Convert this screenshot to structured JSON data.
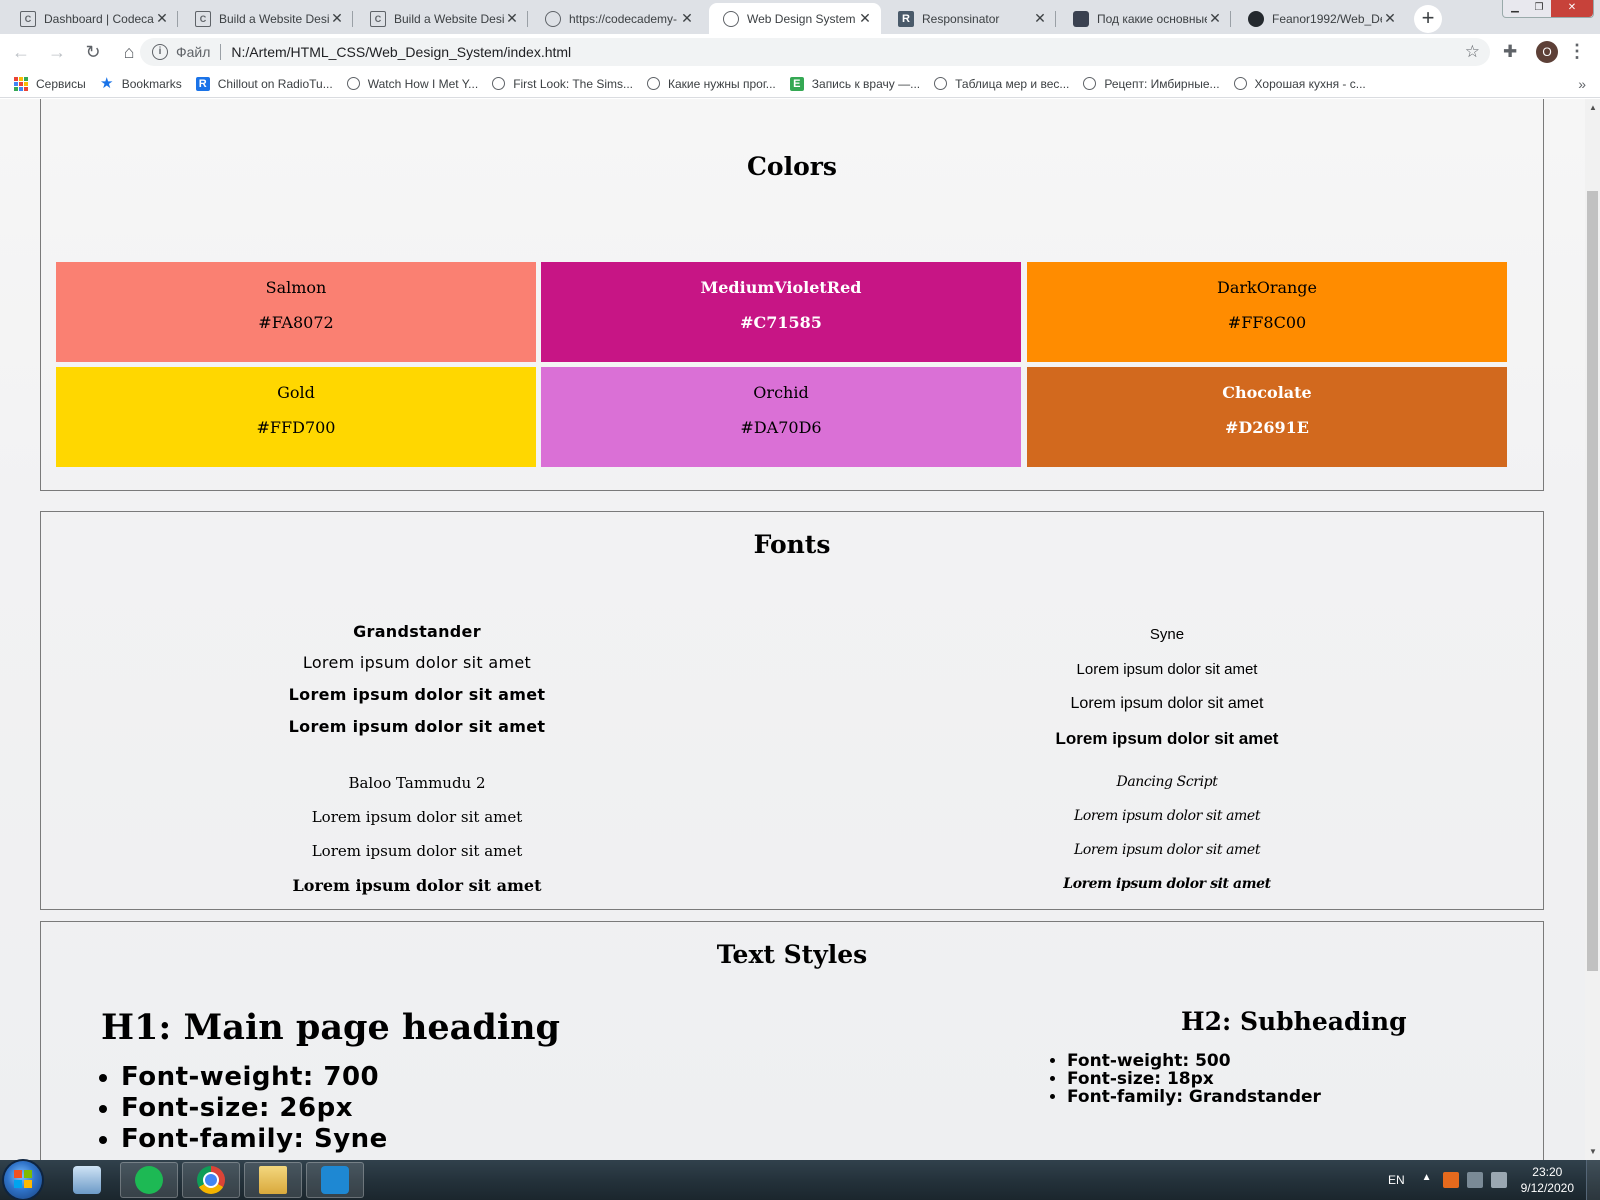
{
  "browser": {
    "tabs": [
      {
        "title": "Dashboard | Codecademy",
        "icon": "codecademy-icon",
        "active": false
      },
      {
        "title": "Build a Website Design System",
        "icon": "codecademy-icon",
        "active": false
      },
      {
        "title": "Build a Website Design System",
        "icon": "codecademy-icon",
        "active": false
      },
      {
        "title": "https://codecademy-",
        "icon": "globe-icon",
        "active": false
      },
      {
        "title": "Web Design System",
        "icon": "globe-icon",
        "active": true
      },
      {
        "title": "Responsinator",
        "icon": "r-icon",
        "active": false
      },
      {
        "title": "Под какие основные",
        "icon": "habr-icon",
        "active": false
      },
      {
        "title": "Feanor1992/Web_De",
        "icon": "github-icon",
        "active": false
      }
    ],
    "address": {
      "scheme_label": "Файл",
      "url": "N:/Artem/HTML_CSS/Web_Design_System/index.html"
    },
    "profile_initial": "O",
    "bookmarks": [
      {
        "label": "Сервисы",
        "icon": "apps-icon"
      },
      {
        "label": "Bookmarks",
        "icon": "star-icon"
      },
      {
        "label": "Chillout on RadioTu...",
        "icon": "radio-icon"
      },
      {
        "label": "Watch How I Met Y...",
        "icon": "globe-icon"
      },
      {
        "label": "First Look: The Sims...",
        "icon": "globe-icon"
      },
      {
        "label": "Какие нужны прог...",
        "icon": "globe-icon"
      },
      {
        "label": "Запись к врачу —...",
        "icon": "e-icon"
      },
      {
        "label": "Таблица мер и вес...",
        "icon": "globe-icon"
      },
      {
        "label": "Рецепт: Имбирные...",
        "icon": "globe-icon"
      },
      {
        "label": "Хорошая кухня - с...",
        "icon": "globe-icon"
      }
    ]
  },
  "page": {
    "colors": {
      "title": "Colors",
      "swatches": [
        {
          "name": "Salmon",
          "hex": "#FA8072",
          "color": "#FA8072"
        },
        {
          "name": "MediumVioletRed",
          "hex": "#C71585",
          "color": "#C71585"
        },
        {
          "name": "DarkOrange",
          "hex": "#FF8C00",
          "color": "#FF8C00"
        },
        {
          "name": "Gold",
          "hex": "#FFD700",
          "color": "#FFD700"
        },
        {
          "name": "Orchid",
          "hex": "#DA70D6",
          "color": "#DA70D6"
        },
        {
          "name": "Chocolate",
          "hex": "#D2691E",
          "color": "#D2691E"
        }
      ]
    },
    "fonts": {
      "title": "Fonts",
      "families": [
        {
          "name": "Grandstander",
          "samples": [
            "Lorem ipsum dolor sit amet",
            "Lorem ipsum dolor sit amet",
            "Lorem ipsum dolor sit amet"
          ]
        },
        {
          "name": "Syne",
          "samples": [
            "Lorem ipsum dolor sit amet",
            "Lorem ipsum dolor sit amet",
            "Lorem ipsum dolor sit amet"
          ]
        },
        {
          "name": "Baloo Tammudu 2",
          "samples": [
            "Lorem ipsum dolor sit amet",
            "Lorem ipsum dolor sit amet",
            "Lorem ipsum dolor sit amet"
          ]
        },
        {
          "name": "Dancing Script",
          "samples": [
            "Lorem ipsum dolor sit amet",
            "Lorem ipsum dolor sit amet",
            "Lorem ipsum dolor sit amet"
          ]
        }
      ]
    },
    "text_styles": {
      "title": "Text Styles",
      "h1": {
        "heading": "H1: Main page heading",
        "props": [
          "Font-weight: 700",
          "Font-size: 26px",
          "Font-family: Syne"
        ]
      },
      "h2": {
        "heading": "H2: Subheading",
        "props": [
          "Font-weight: 500",
          "Font-size: 18px",
          "Font-family: Grandstander"
        ]
      }
    }
  },
  "taskbar": {
    "language": "EN",
    "time": "23:20",
    "date": "9/12/2020"
  }
}
